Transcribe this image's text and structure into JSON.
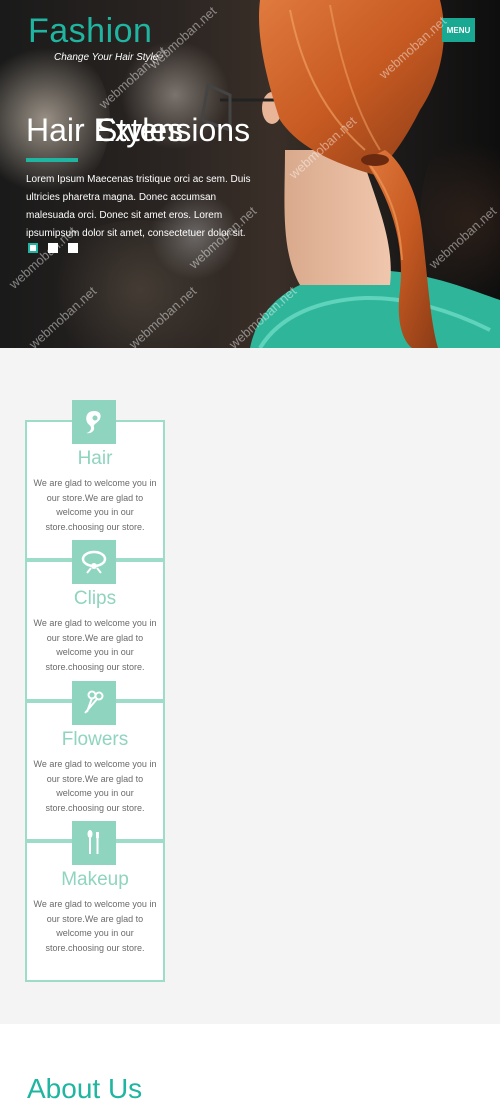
{
  "brand": {
    "logo": "Fashion",
    "tagline": "Change Your Hair Style",
    "menu_label": "MENU"
  },
  "slider": {
    "title": "Hair Extensions",
    "title_overlap": "Styles",
    "text": "Lorem Ipsum Maecenas tristique orci ac sem. Duis ultricies pharetra magna. Donec accumsan malesuada orci. Donec sit amet eros. Lorem ipsumipsum dolor sit amet, consectetuer dolor sit.",
    "dot_count": 3,
    "active_index": 0
  },
  "services": [
    {
      "title": "Hair",
      "icon": "hair-icon",
      "text": "We are glad to welcome you in our store.We are glad to welcome you in our store.choosing our store."
    },
    {
      "title": "Clips",
      "icon": "clip-icon",
      "text": "We are glad to welcome you in our store.We are glad to welcome you in our store.choosing our store."
    },
    {
      "title": "Flowers",
      "icon": "scissors-icon",
      "text": "We are glad to welcome you in our store.We are glad to welcome you in our store.choosing our store."
    },
    {
      "title": "Makeup",
      "icon": "makeup-brush-icon",
      "text": "We are glad to welcome you in our store.We are glad to welcome you in our store.choosing our store."
    }
  ],
  "about": {
    "heading": "About Us"
  },
  "watermark": "webmoban.net",
  "colors": {
    "accent": "#1fb5a0",
    "card_accent": "#8fd4bf",
    "card_border": "#9ddcc9"
  }
}
